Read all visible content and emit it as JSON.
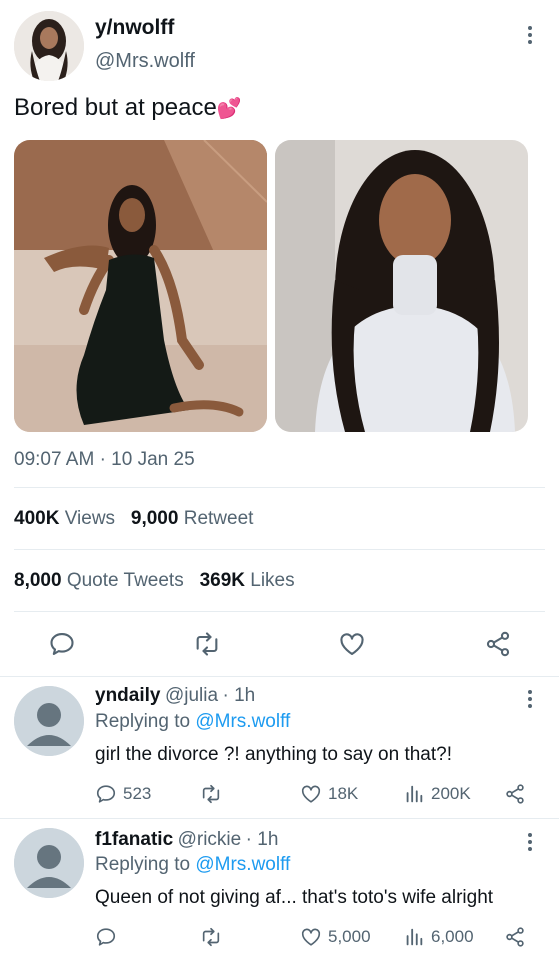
{
  "tweet": {
    "display_name": "y/nwolff",
    "handle": "@Mrs.wolff",
    "text": "Bored but at peace",
    "emoji": "💕",
    "time": "09:07 AM",
    "date": "10 Jan 25",
    "time_sep": "·",
    "stats": {
      "views_count": "400K",
      "views_label": "Views",
      "retweet_count": "9,000",
      "retweet_label": "Retweet",
      "quote_count": "8,000",
      "quote_label": "Quote Tweets",
      "likes_count": "369K",
      "likes_label": "Likes"
    }
  },
  "replies": [
    {
      "name": "yndaily",
      "handle": "@julia",
      "time": "· 1h",
      "replying_prefix": "Replying to",
      "replying_to": "@Mrs.wolff",
      "text": "girl the divorce ?! anything to say on that?!",
      "reply_count": "523",
      "like_count": "18K",
      "view_count": "200K"
    },
    {
      "name": "f1fanatic",
      "handle": "@rickie",
      "time": "· 1h",
      "replying_prefix": "Replying to",
      "replying_to": "@Mrs.wolff",
      "text": "Queen of not giving af... that's toto's wife alright",
      "reply_count": "",
      "like_count": "5,000",
      "view_count": "6,000"
    }
  ],
  "colors": {
    "accent": "#1d9bf0",
    "text_primary": "#0f1419",
    "text_secondary": "#536471",
    "divider": "#e6ecf0"
  },
  "icons": [
    "reply-icon",
    "retweet-icon",
    "like-icon",
    "share-icon",
    "views-icon",
    "more-icon"
  ]
}
